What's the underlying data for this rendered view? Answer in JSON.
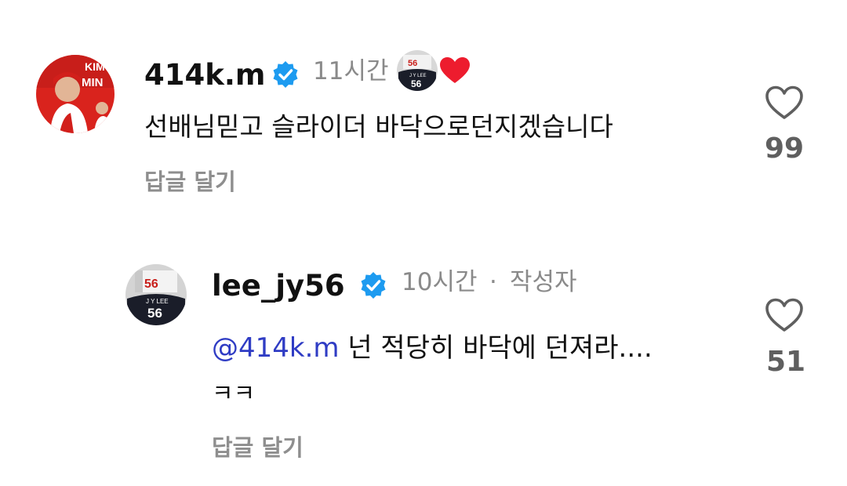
{
  "comment": {
    "username": "414k.m",
    "time": "11시간",
    "text": "선배님믿고 슬라이더 바닥으로던지겠습니다",
    "reply_label": "답글 달기",
    "like_count": "99",
    "avatar_text": "KIM MIN",
    "reaction_jersey_name": "J Y LEE",
    "reaction_jersey_number": "56"
  },
  "reply": {
    "username": "lee_jy56",
    "time": "10시간",
    "dot": "·",
    "author_tag": "작성자",
    "mention": "@414k.m",
    "text_line1": "넌 적당히 바닥에 던져라....",
    "text_line2": "ㅋㅋ",
    "reply_label": "답글 달기",
    "like_count": "51",
    "avatar_jersey_name": "J Y LEE",
    "avatar_jersey_number": "56"
  },
  "colors": {
    "verified": "#1d9bf0",
    "heart_red": "#ed1c2e",
    "mention": "#2f3cc4",
    "muted": "#8e8e8e"
  }
}
